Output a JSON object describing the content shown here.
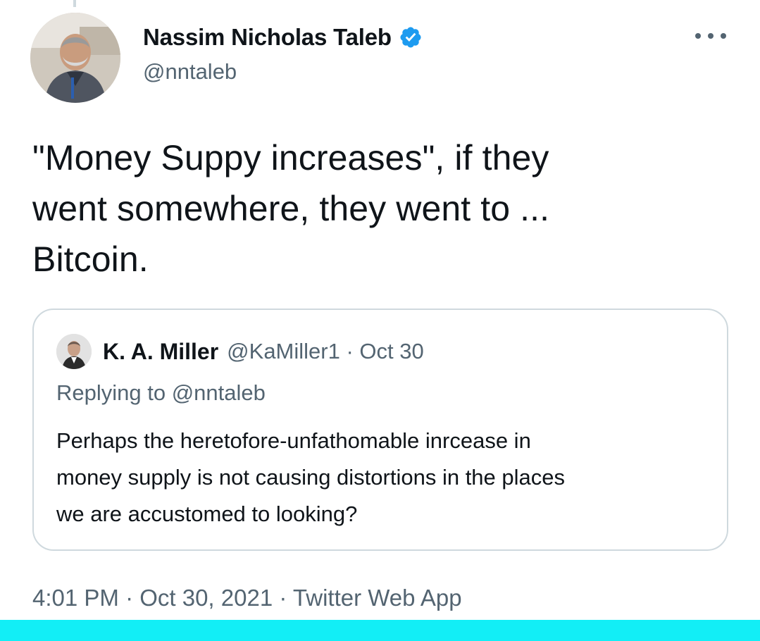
{
  "tweet": {
    "author": {
      "name": "Nassim Nicholas Taleb",
      "handle": "@nntaleb",
      "verified": true
    },
    "text_lines": [
      "\"Money Suppy increases\", if they",
      "went somewhere, they went to ...",
      "Bitcoin."
    ],
    "quote": {
      "author_name": "K. A. Miller",
      "meta": "@KaMiller1 · Oct 30",
      "replying_to": "Replying to @nntaleb",
      "text_lines": [
        "Perhaps the heretofore-unfathomable inrcease in",
        "money supply is not causing distortions in the places",
        "we are accustomed to looking?"
      ]
    },
    "footer": "4:01 PM · Oct 30, 2021 · Twitter Web App"
  },
  "icons": {
    "verified": "verified-badge-icon",
    "more": "more-options-icon"
  },
  "colors": {
    "verified_blue": "#1d9bf0",
    "secondary_text": "#536471",
    "primary_text": "#0f1419",
    "border": "#cfd9de",
    "bottom_bar": "#12eef6"
  }
}
